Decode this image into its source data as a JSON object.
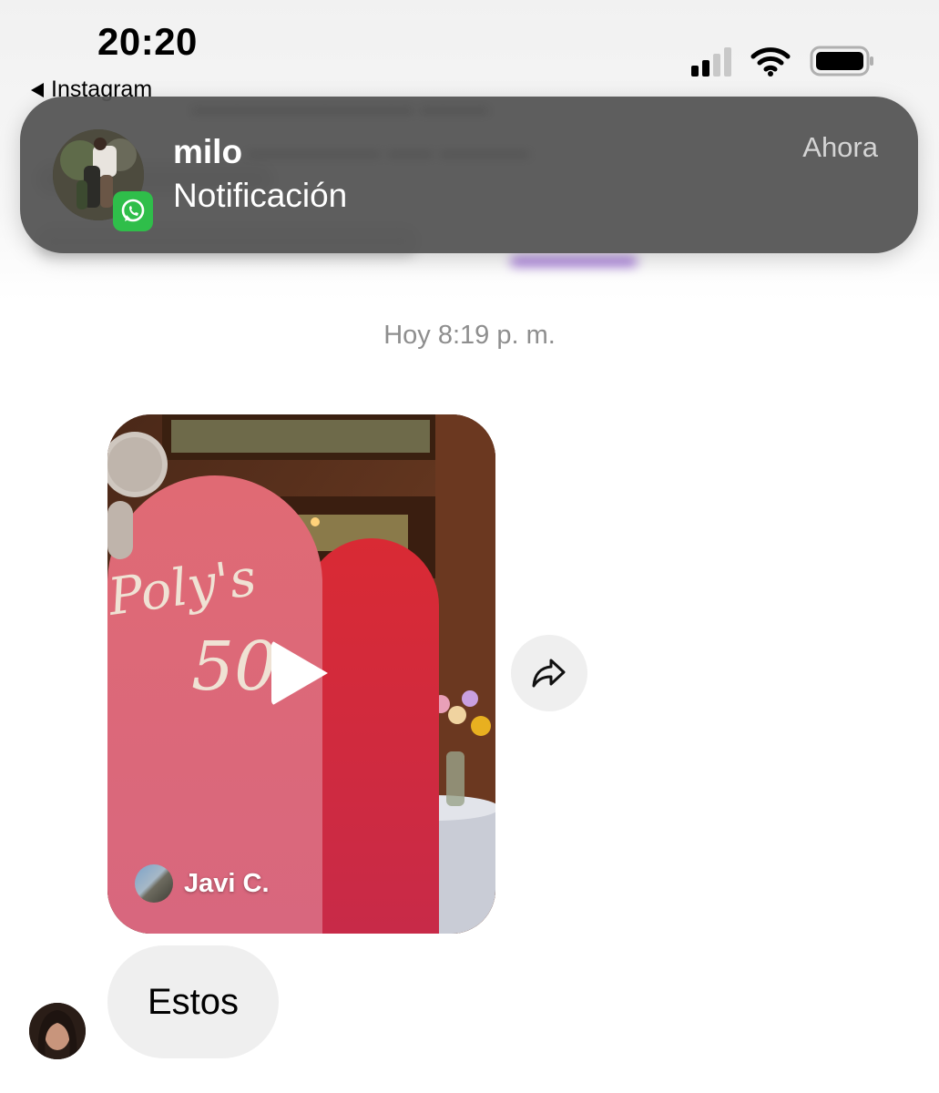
{
  "status_bar": {
    "time": "20:20",
    "back_app_label": "Instagram",
    "signal_icon": "cellular-signal-icon",
    "wifi_icon": "wifi-icon",
    "battery_icon": "battery-icon"
  },
  "notification": {
    "title": "milo",
    "body": "Notificación",
    "time": "Ahora",
    "app_badge_icon": "whatsapp-icon",
    "background_color": "#545454"
  },
  "chat": {
    "timestamp": "Hoy 8:19 p. m.",
    "shared_video": {
      "author_name": "Javi C.",
      "play_icon": "play-icon"
    },
    "share_icon": "share-arrow-icon",
    "messages": [
      {
        "text": "Estos"
      }
    ]
  }
}
